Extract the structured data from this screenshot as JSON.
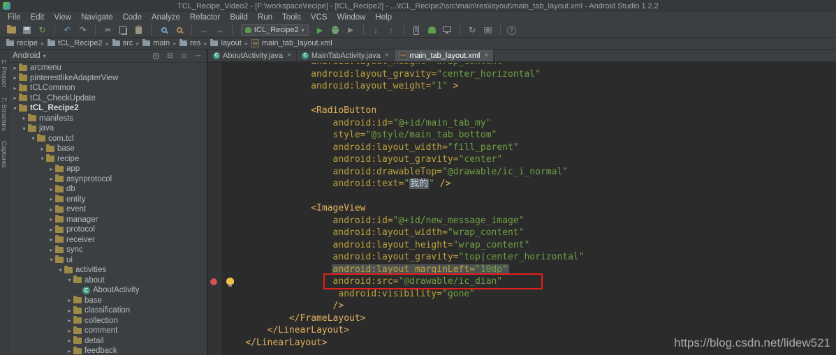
{
  "window": {
    "title": "TCL_Recipe_Video2 - [F:\\workspace\\recipe] - [tCL_Recipe2] - ...\\tCL_Recipe2\\src\\main\\res\\layout\\main_tab_layout.xml - Android Studio 1.2.2"
  },
  "menu": {
    "items": [
      "File",
      "Edit",
      "View",
      "Navigate",
      "Code",
      "Analyze",
      "Refactor",
      "Build",
      "Run",
      "Tools",
      "VCS",
      "Window",
      "Help"
    ]
  },
  "toolbar": {
    "run_config_label": "tCL_Recipe2",
    "items": [
      {
        "type": "icon",
        "name": "open"
      },
      {
        "type": "icon",
        "name": "save"
      },
      {
        "type": "icon",
        "name": "sync"
      },
      {
        "type": "sep"
      },
      {
        "type": "icon",
        "name": "undo"
      },
      {
        "type": "icon",
        "name": "redo"
      },
      {
        "type": "sep"
      },
      {
        "type": "icon",
        "name": "cut"
      },
      {
        "type": "icon",
        "name": "copy"
      },
      {
        "type": "icon",
        "name": "paste"
      },
      {
        "type": "sep"
      },
      {
        "type": "icon",
        "name": "find"
      },
      {
        "type": "icon",
        "name": "replace"
      },
      {
        "type": "sep"
      },
      {
        "type": "icon",
        "name": "back"
      },
      {
        "type": "icon",
        "name": "forward"
      },
      {
        "type": "sep"
      },
      {
        "type": "combo",
        "label": "tCL_Recipe2"
      },
      {
        "type": "icon",
        "name": "run"
      },
      {
        "type": "icon",
        "name": "debug"
      },
      {
        "type": "icon",
        "name": "coverage"
      },
      {
        "type": "sep"
      },
      {
        "type": "icon",
        "name": "update"
      },
      {
        "type": "icon",
        "name": "commit"
      },
      {
        "type": "sep"
      },
      {
        "type": "icon",
        "name": "avd"
      },
      {
        "type": "icon",
        "name": "sdk"
      },
      {
        "type": "icon",
        "name": "monitor"
      },
      {
        "type": "sep"
      },
      {
        "type": "icon",
        "name": "gradle-sync"
      },
      {
        "type": "icon",
        "name": "gradle-console"
      },
      {
        "type": "sep"
      },
      {
        "type": "icon",
        "name": "help"
      }
    ]
  },
  "navbar": {
    "items": [
      {
        "label": "recipe",
        "icon": "folder"
      },
      {
        "label": "tCL_Recipe2",
        "icon": "module"
      },
      {
        "label": "src",
        "icon": "folder"
      },
      {
        "label": "main",
        "icon": "folder"
      },
      {
        "label": "res",
        "icon": "folder"
      },
      {
        "label": "layout",
        "icon": "folder"
      },
      {
        "label": "main_tab_layout.xml",
        "icon": "xml"
      }
    ]
  },
  "tool_stripe": {
    "items": [
      "1: Project",
      "7: Structure",
      "Captures"
    ]
  },
  "project": {
    "header": {
      "title": "Android",
      "icons": [
        "gear",
        "collapse-all",
        "scroll-to-source",
        "hide"
      ]
    },
    "tree": [
      {
        "label": "arcmenu",
        "level": 0,
        "chev": "r",
        "icon": "folder"
      },
      {
        "label": "pinterestlikeAdapterView",
        "level": 0,
        "chev": "r",
        "icon": "folder"
      },
      {
        "label": "tCLCommon",
        "level": 0,
        "chev": "r",
        "icon": "folder"
      },
      {
        "label": "tCL_CheckUpdate",
        "level": 0,
        "chev": "r",
        "icon": "folder"
      },
      {
        "label": "tCL_Recipe2",
        "level": 0,
        "chev": "d",
        "icon": "folder",
        "bold": true
      },
      {
        "label": "manifests",
        "level": 1,
        "chev": "r",
        "icon": "folder"
      },
      {
        "label": "java",
        "level": 1,
        "chev": "d",
        "icon": "folder"
      },
      {
        "label": "com.tcl",
        "level": 2,
        "chev": "d",
        "icon": "package"
      },
      {
        "label": "base",
        "level": 3,
        "chev": "r",
        "icon": "package"
      },
      {
        "label": "recipe",
        "level": 3,
        "chev": "d",
        "icon": "package"
      },
      {
        "label": "app",
        "level": 4,
        "chev": "r",
        "icon": "package"
      },
      {
        "label": "asynprotocol",
        "level": 4,
        "chev": "r",
        "icon": "package"
      },
      {
        "label": "db",
        "level": 4,
        "chev": "r",
        "icon": "package"
      },
      {
        "label": "entity",
        "level": 4,
        "chev": "r",
        "icon": "package"
      },
      {
        "label": "event",
        "level": 4,
        "chev": "r",
        "icon": "package"
      },
      {
        "label": "manager",
        "level": 4,
        "chev": "r",
        "icon": "package"
      },
      {
        "label": "protocol",
        "level": 4,
        "chev": "r",
        "icon": "package"
      },
      {
        "label": "receiver",
        "level": 4,
        "chev": "r",
        "icon": "package"
      },
      {
        "label": "sync",
        "level": 4,
        "chev": "r",
        "icon": "package"
      },
      {
        "label": "ui",
        "level": 4,
        "chev": "d",
        "icon": "package"
      },
      {
        "label": "activities",
        "level": 5,
        "chev": "d",
        "icon": "package"
      },
      {
        "label": "about",
        "level": 6,
        "chev": "d",
        "icon": "package"
      },
      {
        "label": "AboutActivity",
        "level": 7,
        "chev": "",
        "icon": "class"
      },
      {
        "label": "base",
        "level": 6,
        "chev": "r",
        "icon": "package"
      },
      {
        "label": "classification",
        "level": 6,
        "chev": "r",
        "icon": "package"
      },
      {
        "label": "collection",
        "level": 6,
        "chev": "r",
        "icon": "package"
      },
      {
        "label": "comment",
        "level": 6,
        "chev": "r",
        "icon": "package"
      },
      {
        "label": "detail",
        "level": 6,
        "chev": "r",
        "icon": "package"
      },
      {
        "label": "feedback",
        "level": 6,
        "chev": "r",
        "icon": "package"
      }
    ]
  },
  "editor": {
    "tabs": [
      {
        "label": "AboutActivity.java",
        "icon": "class"
      },
      {
        "label": "MainTabActivity.java",
        "icon": "class"
      },
      {
        "label": "main_tab_layout.xml",
        "icon": "xml",
        "active": true
      }
    ],
    "markers": {
      "breakpoint_line": 19,
      "lightbulb_line": 19
    },
    "code": [
      {
        "i": 16,
        "t": [
          [
            "a",
            "android:layout_height="
          ],
          [
            "v",
            "\"wrap_content\""
          ]
        ]
      },
      {
        "i": 16,
        "t": [
          [
            "a",
            "android:layout_gravity="
          ],
          [
            "v",
            "\"center_horizontal\""
          ]
        ]
      },
      {
        "i": 16,
        "t": [
          [
            "a",
            "android:layout_weight="
          ],
          [
            "v",
            "\"1\""
          ],
          [
            "t",
            " >"
          ]
        ]
      },
      {
        "i": 0,
        "t": []
      },
      {
        "i": 16,
        "t": [
          [
            "t",
            "<RadioButton"
          ]
        ]
      },
      {
        "i": 20,
        "t": [
          [
            "a",
            "android:id="
          ],
          [
            "v",
            "\"@+id/main_tab_my\""
          ]
        ]
      },
      {
        "i": 20,
        "t": [
          [
            "a",
            "style="
          ],
          [
            "v",
            "\"@style/main_tab_bottom\""
          ]
        ]
      },
      {
        "i": 20,
        "t": [
          [
            "a",
            "android:layout_width="
          ],
          [
            "v",
            "\"fill_parent\""
          ]
        ]
      },
      {
        "i": 20,
        "t": [
          [
            "a",
            "android:layout_gravity="
          ],
          [
            "v",
            "\"center\""
          ]
        ]
      },
      {
        "i": 20,
        "t": [
          [
            "a",
            "android:drawableTop="
          ],
          [
            "v",
            "\"@drawable/ic_i_normal\""
          ]
        ]
      },
      {
        "i": 20,
        "t": [
          [
            "a",
            "android:text="
          ],
          [
            "v",
            "\""
          ],
          [
            "c",
            "我的"
          ],
          [
            "v",
            "\""
          ],
          [
            "t",
            " />"
          ]
        ]
      },
      {
        "i": 0,
        "t": []
      },
      {
        "i": 16,
        "t": [
          [
            "t",
            "<ImageView"
          ]
        ]
      },
      {
        "i": 20,
        "t": [
          [
            "a",
            "android:id="
          ],
          [
            "v",
            "\"@+id/new_message_image\""
          ]
        ]
      },
      {
        "i": 20,
        "t": [
          [
            "a",
            "android:layout_width="
          ],
          [
            "v",
            "\"wrap_content\""
          ]
        ]
      },
      {
        "i": 20,
        "t": [
          [
            "a",
            "android:layout_height="
          ],
          [
            "v",
            "\"wrap_content\""
          ]
        ]
      },
      {
        "i": 20,
        "t": [
          [
            "a",
            "android:layout_gravity="
          ],
          [
            "v",
            "\"top|center_horizontal\""
          ]
        ]
      },
      {
        "i": 20,
        "f": "hl",
        "t": [
          [
            "a",
            "android:layout_marginLeft="
          ],
          [
            "v",
            "\"10dp\""
          ]
        ]
      },
      {
        "i": 20,
        "f": "box",
        "t": [
          [
            "a",
            "android:src="
          ],
          [
            "v",
            "\"@drawable/ic_dian\""
          ]
        ]
      },
      {
        "i": 21,
        "t": [
          [
            "a",
            "android:visibility="
          ],
          [
            "v",
            "\"gone\""
          ]
        ]
      },
      {
        "i": 20,
        "t": [
          [
            "t",
            "/>"
          ]
        ]
      },
      {
        "i": 12,
        "t": [
          [
            "t",
            "</FrameLayout>"
          ]
        ]
      },
      {
        "i": 8,
        "t": [
          [
            "t",
            "</LinearLayout>"
          ]
        ]
      },
      {
        "i": 4,
        "t": [
          [
            "t",
            "</LinearLayout>"
          ]
        ]
      }
    ]
  },
  "watermark": "https://blog.csdn.net/lidew521",
  "colors": {
    "annotation_box": "#e31e1e",
    "breakpoint": "#d25252",
    "highlight_line": "#4f5452",
    "editor_bg": "#2b2b2b",
    "chrome_bg": "#3c3f41"
  }
}
